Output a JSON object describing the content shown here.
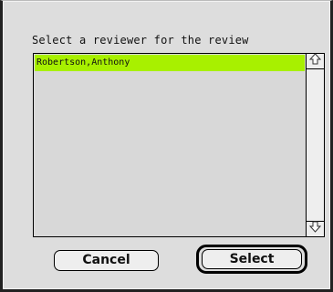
{
  "dialog": {
    "prompt": "Select a reviewer for the review",
    "reviewers": [
      {
        "name": "Robertson,Anthony",
        "selected": true
      }
    ],
    "selection_color": "#a8f000",
    "scroll_up_icon": "up-arrow-icon",
    "scroll_down_icon": "down-arrow-icon",
    "buttons": {
      "cancel_label": "Cancel",
      "select_label": "Select",
      "default": "select"
    }
  }
}
